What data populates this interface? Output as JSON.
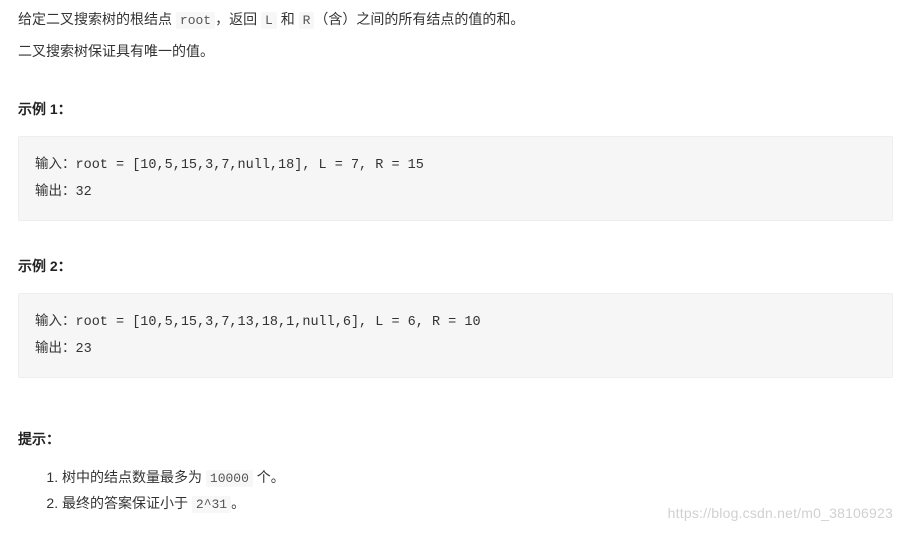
{
  "intro": {
    "p1_a": "给定二叉搜索树的根结点 ",
    "p1_root": "root",
    "p1_b": "，返回 ",
    "p1_L": "L",
    "p1_c": " 和 ",
    "p1_R": "R",
    "p1_d": "（含）之间的所有结点的值的和。",
    "p2": "二叉搜索树保证具有唯一的值。"
  },
  "example1": {
    "title": "示例 1：",
    "input_label": "输入：",
    "input_text": "root = [10,5,15,3,7,null,18], L = 7, R = 15",
    "output_label": "输出：",
    "output_text": "32"
  },
  "example2": {
    "title": "示例 2：",
    "input_label": "输入：",
    "input_text": "root = [10,5,15,3,7,13,18,1,null,6], L = 6, R = 10",
    "output_label": "输出：",
    "output_text": "23"
  },
  "hints": {
    "title": "提示：",
    "items": [
      {
        "a": "树中的结点数量最多为 ",
        "code": "10000",
        "b": " 个。"
      },
      {
        "a": "最终的答案保证小于 ",
        "code": "2^31",
        "b": "。"
      }
    ]
  },
  "watermark": "https://blog.csdn.net/m0_38106923"
}
